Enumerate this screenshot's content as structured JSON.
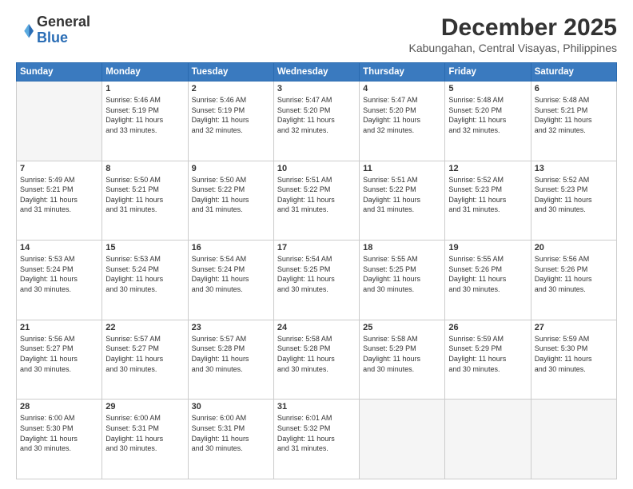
{
  "header": {
    "logo_general": "General",
    "logo_blue": "Blue",
    "main_title": "December 2025",
    "subtitle": "Kabungahan, Central Visayas, Philippines"
  },
  "calendar": {
    "days_of_week": [
      "Sunday",
      "Monday",
      "Tuesday",
      "Wednesday",
      "Thursday",
      "Friday",
      "Saturday"
    ],
    "weeks": [
      [
        {
          "day": "",
          "text": ""
        },
        {
          "day": "1",
          "text": "Sunrise: 5:46 AM\nSunset: 5:19 PM\nDaylight: 11 hours\nand 33 minutes."
        },
        {
          "day": "2",
          "text": "Sunrise: 5:46 AM\nSunset: 5:19 PM\nDaylight: 11 hours\nand 32 minutes."
        },
        {
          "day": "3",
          "text": "Sunrise: 5:47 AM\nSunset: 5:20 PM\nDaylight: 11 hours\nand 32 minutes."
        },
        {
          "day": "4",
          "text": "Sunrise: 5:47 AM\nSunset: 5:20 PM\nDaylight: 11 hours\nand 32 minutes."
        },
        {
          "day": "5",
          "text": "Sunrise: 5:48 AM\nSunset: 5:20 PM\nDaylight: 11 hours\nand 32 minutes."
        },
        {
          "day": "6",
          "text": "Sunrise: 5:48 AM\nSunset: 5:21 PM\nDaylight: 11 hours\nand 32 minutes."
        }
      ],
      [
        {
          "day": "7",
          "text": "Sunrise: 5:49 AM\nSunset: 5:21 PM\nDaylight: 11 hours\nand 31 minutes."
        },
        {
          "day": "8",
          "text": "Sunrise: 5:50 AM\nSunset: 5:21 PM\nDaylight: 11 hours\nand 31 minutes."
        },
        {
          "day": "9",
          "text": "Sunrise: 5:50 AM\nSunset: 5:22 PM\nDaylight: 11 hours\nand 31 minutes."
        },
        {
          "day": "10",
          "text": "Sunrise: 5:51 AM\nSunset: 5:22 PM\nDaylight: 11 hours\nand 31 minutes."
        },
        {
          "day": "11",
          "text": "Sunrise: 5:51 AM\nSunset: 5:22 PM\nDaylight: 11 hours\nand 31 minutes."
        },
        {
          "day": "12",
          "text": "Sunrise: 5:52 AM\nSunset: 5:23 PM\nDaylight: 11 hours\nand 31 minutes."
        },
        {
          "day": "13",
          "text": "Sunrise: 5:52 AM\nSunset: 5:23 PM\nDaylight: 11 hours\nand 30 minutes."
        }
      ],
      [
        {
          "day": "14",
          "text": "Sunrise: 5:53 AM\nSunset: 5:24 PM\nDaylight: 11 hours\nand 30 minutes."
        },
        {
          "day": "15",
          "text": "Sunrise: 5:53 AM\nSunset: 5:24 PM\nDaylight: 11 hours\nand 30 minutes."
        },
        {
          "day": "16",
          "text": "Sunrise: 5:54 AM\nSunset: 5:24 PM\nDaylight: 11 hours\nand 30 minutes."
        },
        {
          "day": "17",
          "text": "Sunrise: 5:54 AM\nSunset: 5:25 PM\nDaylight: 11 hours\nand 30 minutes."
        },
        {
          "day": "18",
          "text": "Sunrise: 5:55 AM\nSunset: 5:25 PM\nDaylight: 11 hours\nand 30 minutes."
        },
        {
          "day": "19",
          "text": "Sunrise: 5:55 AM\nSunset: 5:26 PM\nDaylight: 11 hours\nand 30 minutes."
        },
        {
          "day": "20",
          "text": "Sunrise: 5:56 AM\nSunset: 5:26 PM\nDaylight: 11 hours\nand 30 minutes."
        }
      ],
      [
        {
          "day": "21",
          "text": "Sunrise: 5:56 AM\nSunset: 5:27 PM\nDaylight: 11 hours\nand 30 minutes."
        },
        {
          "day": "22",
          "text": "Sunrise: 5:57 AM\nSunset: 5:27 PM\nDaylight: 11 hours\nand 30 minutes."
        },
        {
          "day": "23",
          "text": "Sunrise: 5:57 AM\nSunset: 5:28 PM\nDaylight: 11 hours\nand 30 minutes."
        },
        {
          "day": "24",
          "text": "Sunrise: 5:58 AM\nSunset: 5:28 PM\nDaylight: 11 hours\nand 30 minutes."
        },
        {
          "day": "25",
          "text": "Sunrise: 5:58 AM\nSunset: 5:29 PM\nDaylight: 11 hours\nand 30 minutes."
        },
        {
          "day": "26",
          "text": "Sunrise: 5:59 AM\nSunset: 5:29 PM\nDaylight: 11 hours\nand 30 minutes."
        },
        {
          "day": "27",
          "text": "Sunrise: 5:59 AM\nSunset: 5:30 PM\nDaylight: 11 hours\nand 30 minutes."
        }
      ],
      [
        {
          "day": "28",
          "text": "Sunrise: 6:00 AM\nSunset: 5:30 PM\nDaylight: 11 hours\nand 30 minutes."
        },
        {
          "day": "29",
          "text": "Sunrise: 6:00 AM\nSunset: 5:31 PM\nDaylight: 11 hours\nand 30 minutes."
        },
        {
          "day": "30",
          "text": "Sunrise: 6:00 AM\nSunset: 5:31 PM\nDaylight: 11 hours\nand 30 minutes."
        },
        {
          "day": "31",
          "text": "Sunrise: 6:01 AM\nSunset: 5:32 PM\nDaylight: 11 hours\nand 31 minutes."
        },
        {
          "day": "",
          "text": ""
        },
        {
          "day": "",
          "text": ""
        },
        {
          "day": "",
          "text": ""
        }
      ]
    ]
  }
}
